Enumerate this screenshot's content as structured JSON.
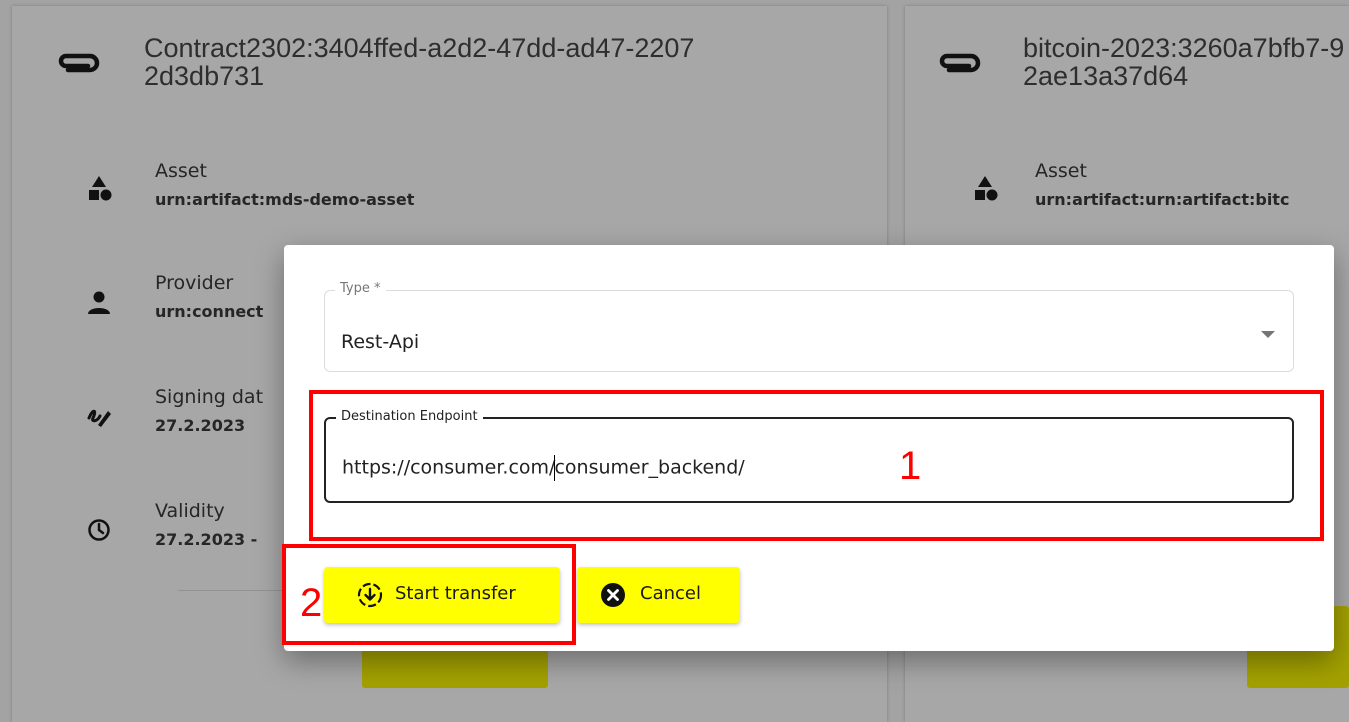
{
  "cards": {
    "left": {
      "title": "Contract2302:3404ffed-a2d2-47dd-ad47-22072d3db731",
      "asset_label": "Asset",
      "asset_value": "urn:artifact:mds-demo-asset",
      "provider_label": "Provider",
      "provider_value": "urn:connect",
      "signing_label": "Signing dat",
      "signing_value": "27.2.2023",
      "validity_label": "Validity",
      "validity_value": "27.2.2023 -"
    },
    "right": {
      "title": "bitcoin-2023:3260a7bfb7-92ae13a37d64",
      "asset_label": "Asset",
      "asset_value": "urn:artifact:urn:artifact:bitc"
    }
  },
  "icons": {
    "clip": "paperclip-icon",
    "asset": "shapes-icon",
    "provider": "person-icon",
    "signing": "signature-icon",
    "validity": "clock-icon",
    "start": "download-circle-icon",
    "cancel": "cancel-circle-icon"
  },
  "dialog": {
    "type_label": "Type *",
    "type_value": "Rest-Api",
    "dest_label": "Destination Endpoint",
    "dest_value_before_cursor": "https://consumer.com/",
    "dest_value_after_cursor": "consumer_backend/",
    "start_label": "Start transfer",
    "cancel_label": "Cancel"
  },
  "annotations": {
    "box1_number": "1",
    "box2_number": "2",
    "color": "#ff0000"
  },
  "colors": {
    "button": "#ffff00",
    "backdrop": "#a3a3a3",
    "dialog": "#ffffff"
  }
}
